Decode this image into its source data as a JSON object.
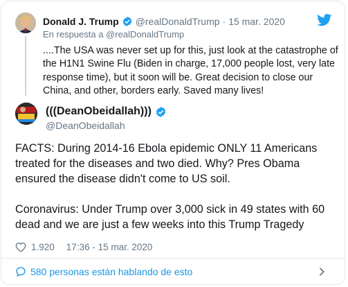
{
  "quoted_tweet": {
    "author_name": "Donald J. Trump",
    "author_handle": "@realDonaldTrump",
    "separator": "·",
    "date": "15 mar. 2020",
    "reply_prefix": "En respuesta a",
    "reply_mention": "@realDonaldTrump",
    "text": "....The USA was never set up for this, just look at the catastrophe of the H1N1 Swine Flu (Biden in charge, 17,000 people lost, very late response time), but it soon will be. Great decision to close our China, and other, borders early. Saved many lives!"
  },
  "main_tweet": {
    "author_name": "(((DeanObeidallah)))",
    "author_handle": "@DeanObeidallah",
    "paragraph_1": "FACTS: During 2014-16 Ebola epidemic ONLY 11 Americans treated for the diseases and two died. Why? Pres Obama ensured the disease didn't come to US soil.",
    "paragraph_2": "Coronavirus: Under Trump over 3,000 sick in 49 states with  60 dead and we are just a few weeks into this Trump Tragedy",
    "likes": "1.920",
    "timestamp": "17:36 - 15 mar. 2020"
  },
  "footer": {
    "conversation_text": "580 personas están hablando de esto"
  },
  "colors": {
    "link_blue": "#1b95e0",
    "muted_gray": "#657786",
    "verified_blue": "#1da1f2",
    "border": "#e1e8ed"
  },
  "icons": {
    "brand": "twitter-bird-icon",
    "verified": "verified-badge-icon",
    "like": "heart-icon",
    "reply": "speech-bubble-icon",
    "more": "chevron-right-icon"
  }
}
